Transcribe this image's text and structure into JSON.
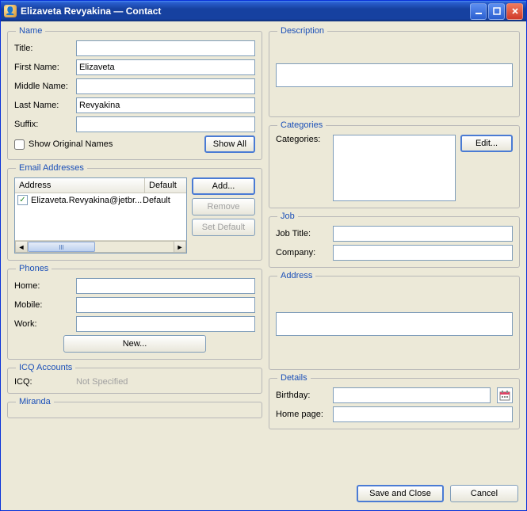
{
  "window": {
    "title": "Elizaveta Revyakina — Contact"
  },
  "name": {
    "legend": "Name",
    "title_label": "Title:",
    "title_value": "",
    "first_label": "First Name:",
    "first_value": "Elizaveta",
    "middle_label": "Middle Name:",
    "middle_value": "",
    "last_label": "Last Name:",
    "last_value": "Revyakina",
    "suffix_label": "Suffix:",
    "suffix_value": "",
    "show_original": "Show Original Names",
    "show_all": "Show All"
  },
  "emails": {
    "legend": "Email Addresses",
    "col_address": "Address",
    "col_default": "Default",
    "rows": [
      {
        "checked": true,
        "address": "Elizaveta.Revyakina@jetbr...",
        "default": "Default"
      }
    ],
    "add": "Add...",
    "remove": "Remove",
    "set_default": "Set Default"
  },
  "phones": {
    "legend": "Phones",
    "home_label": "Home:",
    "home_value": "",
    "mobile_label": "Mobile:",
    "mobile_value": "",
    "work_label": "Work:",
    "work_value": "",
    "new_btn": "New..."
  },
  "icq": {
    "legend": "ICQ Accounts",
    "label": "ICQ:",
    "value": "Not Specified"
  },
  "miranda": {
    "legend": "Miranda"
  },
  "description": {
    "legend": "Description",
    "value": ""
  },
  "categories": {
    "legend": "Categories",
    "label": "Categories:",
    "edit": "Edit..."
  },
  "job": {
    "legend": "Job",
    "title_label": "Job Title:",
    "title_value": "",
    "company_label": "Company:",
    "company_value": ""
  },
  "address": {
    "legend": "Address",
    "value": ""
  },
  "details": {
    "legend": "Details",
    "birthday_label": "Birthday:",
    "birthday_value": "",
    "homepage_label": "Home page:",
    "homepage_value": ""
  },
  "footer": {
    "save": "Save and Close",
    "cancel": "Cancel"
  }
}
